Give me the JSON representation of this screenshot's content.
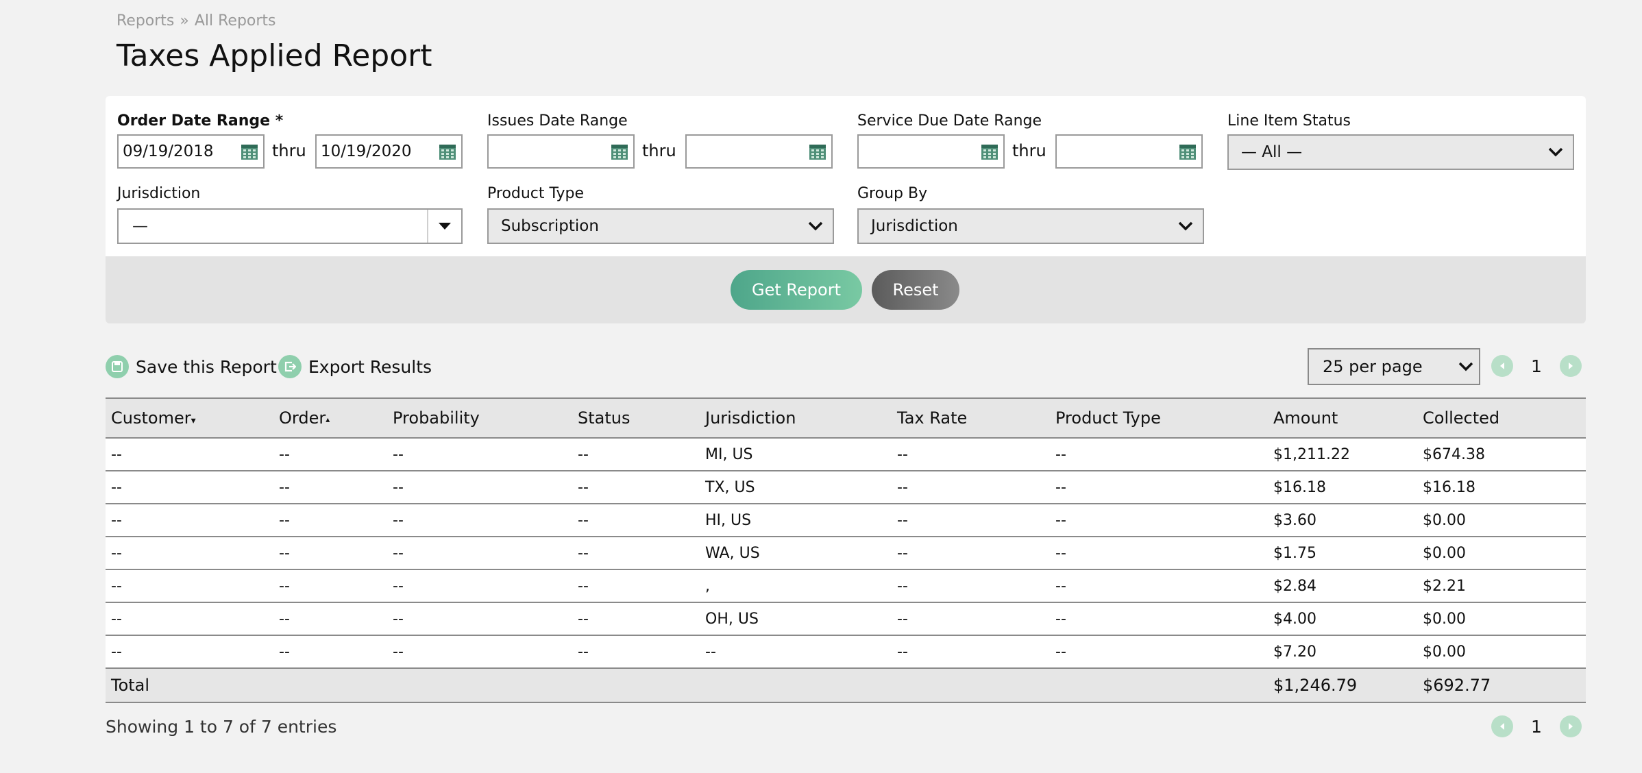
{
  "breadcrumb": {
    "root": "Reports",
    "separator": "»",
    "current": "All Reports"
  },
  "page": {
    "title": "Taxes Applied Report"
  },
  "filters": {
    "order_date": {
      "label": "Order Date Range *",
      "from": "09/19/2018",
      "to": "10/19/2020"
    },
    "issues_date": {
      "label": "Issues Date Range",
      "from": "",
      "to": ""
    },
    "service_due_date": {
      "label": "Service Due Date Range",
      "from": "",
      "to": ""
    },
    "thru": "thru",
    "line_item_status": {
      "label": "Line Item Status",
      "value": "— All —"
    },
    "jurisdiction": {
      "label": "Jurisdiction",
      "value": "—"
    },
    "product_type": {
      "label": "Product Type",
      "value": "Subscription"
    },
    "group_by": {
      "label": "Group By",
      "value": "Jurisdiction"
    }
  },
  "actions": {
    "get_report": "Get Report",
    "reset": "Reset"
  },
  "toolbar": {
    "save_label": "Save this Report",
    "export_label": "Export Results",
    "per_page": "25 per page",
    "page": "1"
  },
  "table": {
    "columns": [
      "Customer",
      "Order",
      "Probability",
      "Status",
      "Jurisdiction",
      "Tax Rate",
      "Product Type",
      "Amount",
      "Collected"
    ],
    "rows": [
      [
        "--",
        "--",
        "--",
        "--",
        "MI, US",
        "--",
        "--",
        "$1,211.22",
        "$674.38"
      ],
      [
        "--",
        "--",
        "--",
        "--",
        "TX, US",
        "--",
        "--",
        "$16.18",
        "$16.18"
      ],
      [
        "--",
        "--",
        "--",
        "--",
        "HI, US",
        "--",
        "--",
        "$3.60",
        "$0.00"
      ],
      [
        "--",
        "--",
        "--",
        "--",
        "WA, US",
        "--",
        "--",
        "$1.75",
        "$0.00"
      ],
      [
        "--",
        "--",
        "--",
        "--",
        ",",
        "--",
        "--",
        "$2.84",
        "$2.21"
      ],
      [
        "--",
        "--",
        "--",
        "--",
        "OH, US",
        "--",
        "--",
        "$4.00",
        "$0.00"
      ],
      [
        "--",
        "--",
        "--",
        "--",
        "--",
        "--",
        "--",
        "$7.20",
        "$0.00"
      ]
    ],
    "total": {
      "label": "Total",
      "amount": "$1,246.79",
      "collected": "$692.77"
    }
  },
  "footer": {
    "showing": "Showing 1 to 7 of 7 entries",
    "page": "1"
  },
  "colors": {
    "accent": "#4ea68a",
    "icon_green": "#8fcfad",
    "pager_green": "#b8dfc8",
    "reset_gray": "#6e6e6e"
  }
}
